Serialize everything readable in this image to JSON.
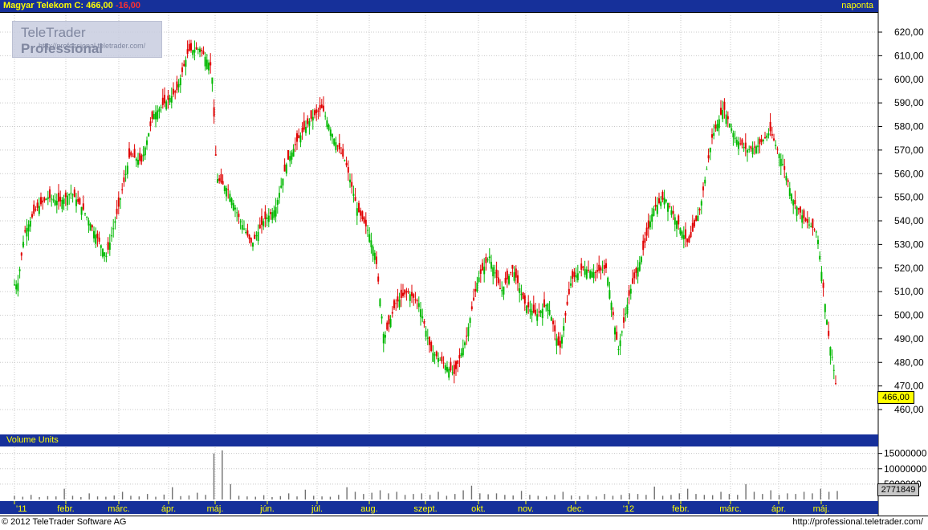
{
  "header": {
    "title": "Magyar Telekom C: 466,00",
    "change": "-16,00",
    "period": "naponta"
  },
  "logo": {
    "name": "TeleTrader",
    "name_bold": "Professional",
    "url": "http://professional.teletrader.com/"
  },
  "volume_panel": {
    "title": "Volume Units",
    "last_volume": "2771849"
  },
  "footer": {
    "copyright": "© 2012 TeleTrader Software AG",
    "url": "http://professional.teletrader.com/"
  },
  "colors": {
    "up": "#00b800",
    "down": "#e00000",
    "header_bg": "#16309a",
    "header_text": "#ffff00",
    "grid": "#c0c0c0"
  },
  "chart_data": [
    {
      "type": "candlestick",
      "title": "Magyar Telekom",
      "last_price": "466,00",
      "ylim": [
        450,
        630
      ],
      "y_ticks": [
        "460,00",
        "470,00",
        "480,00",
        "490,00",
        "500,00",
        "510,00",
        "520,00",
        "530,00",
        "540,00",
        "550,00",
        "560,00",
        "570,00",
        "580,00",
        "590,00",
        "600,00",
        "610,00",
        "620,00"
      ],
      "x_ticks": [
        "'11",
        "febr.",
        "márc.",
        "ápr.",
        "máj.",
        "jún.",
        "júl.",
        "aug.",
        "szept.",
        "okt.",
        "nov.",
        "dec.",
        "'12",
        "febr.",
        "márc.",
        "ápr.",
        "máj."
      ],
      "grid": true,
      "close_path": [
        [
          "2011-01-03",
          513
        ],
        [
          "2011-01-07",
          535
        ],
        [
          "2011-01-14",
          545
        ],
        [
          "2011-01-21",
          550
        ],
        [
          "2011-01-28",
          548
        ],
        [
          "2011-02-04",
          552
        ],
        [
          "2011-02-11",
          545
        ],
        [
          "2011-02-18",
          535
        ],
        [
          "2011-02-25",
          525
        ],
        [
          "2011-03-04",
          545
        ],
        [
          "2011-03-11",
          568
        ],
        [
          "2011-03-18",
          565
        ],
        [
          "2011-03-25",
          585
        ],
        [
          "2011-04-01",
          590
        ],
        [
          "2011-04-08",
          595
        ],
        [
          "2011-04-15",
          612
        ],
        [
          "2011-04-22",
          613
        ],
        [
          "2011-04-29",
          605
        ],
        [
          "2011-05-02",
          558
        ],
        [
          "2011-05-09",
          553
        ],
        [
          "2011-05-16",
          540
        ],
        [
          "2011-05-23",
          530
        ],
        [
          "2011-05-30",
          540
        ],
        [
          "2011-06-06",
          545
        ],
        [
          "2011-06-13",
          565
        ],
        [
          "2011-06-20",
          575
        ],
        [
          "2011-06-27",
          583
        ],
        [
          "2011-07-04",
          588
        ],
        [
          "2011-07-11",
          575
        ],
        [
          "2011-07-18",
          565
        ],
        [
          "2011-07-25",
          545
        ],
        [
          "2011-08-01",
          535
        ],
        [
          "2011-08-05",
          525
        ],
        [
          "2011-08-10",
          490
        ],
        [
          "2011-08-17",
          505
        ],
        [
          "2011-08-24",
          510
        ],
        [
          "2011-08-31",
          505
        ],
        [
          "2011-09-07",
          485
        ],
        [
          "2011-09-14",
          480
        ],
        [
          "2011-09-21",
          475
        ],
        [
          "2011-09-28",
          490
        ],
        [
          "2011-10-05",
          515
        ],
        [
          "2011-10-12",
          525
        ],
        [
          "2011-10-19",
          510
        ],
        [
          "2011-10-26",
          520
        ],
        [
          "2011-11-02",
          505
        ],
        [
          "2011-11-09",
          500
        ],
        [
          "2011-11-16",
          505
        ],
        [
          "2011-11-23",
          485
        ],
        [
          "2011-11-30",
          515
        ],
        [
          "2011-12-07",
          520
        ],
        [
          "2011-12-14",
          518
        ],
        [
          "2011-12-21",
          520
        ],
        [
          "2011-12-28",
          485
        ],
        [
          "2012-01-04",
          510
        ],
        [
          "2012-01-11",
          525
        ],
        [
          "2012-01-18",
          545
        ],
        [
          "2012-01-25",
          550
        ],
        [
          "2012-02-01",
          540
        ],
        [
          "2012-02-08",
          530
        ],
        [
          "2012-02-15",
          545
        ],
        [
          "2012-02-22",
          575
        ],
        [
          "2012-02-29",
          588
        ],
        [
          "2012-03-07",
          575
        ],
        [
          "2012-03-14",
          570
        ],
        [
          "2012-03-21",
          572
        ],
        [
          "2012-03-28",
          578
        ],
        [
          "2012-04-04",
          565
        ],
        [
          "2012-04-11",
          548
        ],
        [
          "2012-04-18",
          540
        ],
        [
          "2012-04-25",
          535
        ],
        [
          "2012-05-02",
          490
        ],
        [
          "2012-05-04",
          482
        ],
        [
          "2012-05-07",
          466
        ]
      ]
    },
    {
      "type": "bar",
      "title": "Volume Units",
      "y_ticks": [
        "5000000",
        "10000000",
        "15000000"
      ],
      "ylim": [
        0,
        17000000
      ],
      "last_value": 2771849,
      "values": [
        1200000,
        900000,
        1500000,
        800000,
        1100000,
        1000000,
        3500000,
        1200000,
        800000,
        2000000,
        1000000,
        900000,
        1300000,
        2500000,
        1200000,
        1000000,
        1800000,
        900000,
        1600000,
        4000000,
        1100000,
        1300000,
        2200000,
        1500000,
        15000000,
        16000000,
        5000000,
        1200000,
        1000000,
        900000,
        1400000,
        800000,
        1100000,
        2000000,
        1000000,
        3200000,
        1200000,
        1000000,
        900000,
        1500000,
        4000000,
        2500000,
        1800000,
        2200000,
        3000000,
        2000000,
        2500000,
        1500000,
        1800000,
        2000000,
        1500000,
        2500000,
        1200000,
        1800000,
        3000000,
        4500000,
        2000000,
        1700000,
        2000000,
        1500000,
        1300000,
        2800000,
        1500000,
        1200000,
        1000000,
        1500000,
        2500000,
        1300000,
        1100000,
        1500000,
        1000000,
        1800000,
        1200000,
        1500000,
        2000000,
        1800000,
        1500000,
        4200000,
        1200000,
        1500000,
        2000000,
        3500000,
        1800000,
        1500000,
        1400000,
        2500000,
        1800000,
        1500000,
        5000000,
        2500000,
        1800000,
        3000000,
        1500000,
        2000000,
        1800000,
        2500000,
        2000000,
        3500000,
        2500000,
        2771849
      ]
    }
  ]
}
